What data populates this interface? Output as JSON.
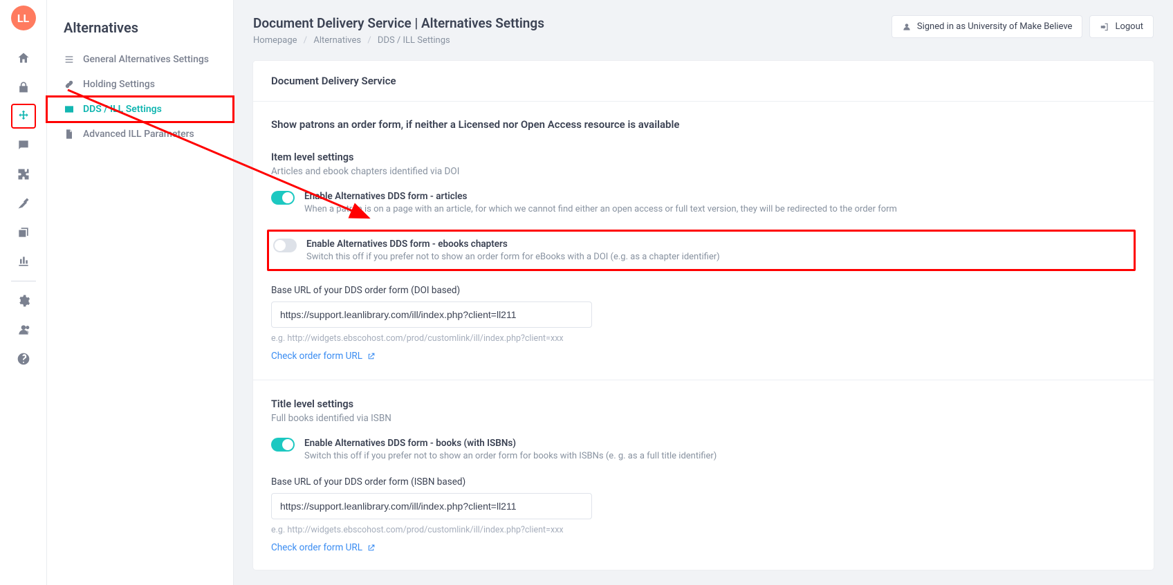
{
  "logo_text": "LL",
  "sidebar": {
    "title": "Alternatives",
    "items": [
      {
        "label": "General Alternatives Settings"
      },
      {
        "label": "Holding Settings"
      },
      {
        "label": "DDS / ILL Settings",
        "active": true
      },
      {
        "label": "Advanced ILL Parameters"
      }
    ]
  },
  "header": {
    "title": "Document Delivery Service | Alternatives Settings",
    "breadcrumb": [
      "Homepage",
      "Alternatives",
      "DDS / ILL Settings"
    ],
    "signed_in": "Signed in as University of Make Believe",
    "logout": "Logout"
  },
  "card": {
    "title": "Document Delivery Service",
    "intro": "Show patrons an order form, if neither a Licensed nor Open Access resource is available",
    "item_level": {
      "title": "Item level settings",
      "subtitle": "Articles and ebook chapters identified via DOI",
      "toggle_articles": {
        "on": true,
        "label": "Enable Alternatives DDS form - articles",
        "desc": "When a patron is on a page with an article, for which we cannot find either an open access or full text version, they will be redirected to the order form"
      },
      "toggle_ebooks": {
        "on": false,
        "label": "Enable Alternatives DDS form - ebooks chapters",
        "desc": "Switch this off if you prefer not to show an order form for eBooks with a DOI (e.g. as a chapter identifier)"
      },
      "url_label": "Base URL of your DDS order form (DOI based)",
      "url_value": "https://support.leanlibrary.com/ill/index.php?client=ll211",
      "url_hint": "e.g. http://widgets.ebscohost.com/prod/customlink/ill/index.php?client=xxx",
      "check_link": "Check order form URL"
    },
    "title_level": {
      "title": "Title level settings",
      "subtitle": "Full books identified via ISBN",
      "toggle_books": {
        "on": true,
        "label": "Enable Alternatives DDS form - books (with ISBNs)",
        "desc": "Switch this off if you prefer not to show an order form for books with ISBNs (e. g. as a full title identifier)"
      },
      "url_label": "Base URL of your DDS order form (ISBN based)",
      "url_value": "https://support.leanlibrary.com/ill/index.php?client=ll211",
      "url_hint": "e.g. http://widgets.ebscohost.com/prod/customlink/ill/index.php?client=xxx",
      "check_link": "Check order form URL"
    }
  }
}
